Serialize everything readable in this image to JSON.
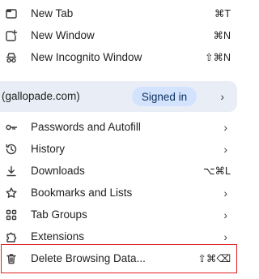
{
  "menu": {
    "items_top": [
      {
        "label": "New Tab",
        "shortcut": "⌘T",
        "icon": "new-tab-icon"
      },
      {
        "label": "New Window",
        "shortcut": "⌘N",
        "icon": "new-window-icon"
      },
      {
        "label": "New Incognito Window",
        "shortcut": "⇧⌘N",
        "icon": "incognito-icon"
      }
    ],
    "profile": {
      "email": "(gallopade.com)",
      "status": "Signed in",
      "chevron": "›"
    },
    "items_bottom": [
      {
        "label": "Passwords and Autofill",
        "chevron": "›",
        "icon": "key-icon"
      },
      {
        "label": "History",
        "chevron": "›",
        "icon": "history-icon"
      },
      {
        "label": "Downloads",
        "shortcut": "⌥⌘L",
        "icon": "download-icon"
      },
      {
        "label": "Bookmarks and Lists",
        "chevron": "›",
        "icon": "star-icon"
      },
      {
        "label": "Tab Groups",
        "chevron": "›",
        "icon": "tab-groups-icon"
      },
      {
        "label": "Extensions",
        "chevron": "›",
        "icon": "puzzle-icon"
      },
      {
        "label": "Delete Browsing Data...",
        "shortcut": "⇧⌘⌫",
        "icon": "trash-icon"
      }
    ],
    "highlight_color": "#e02020",
    "profile_bg": "#e9eef6",
    "badge_bg": "#d3e3fd"
  }
}
